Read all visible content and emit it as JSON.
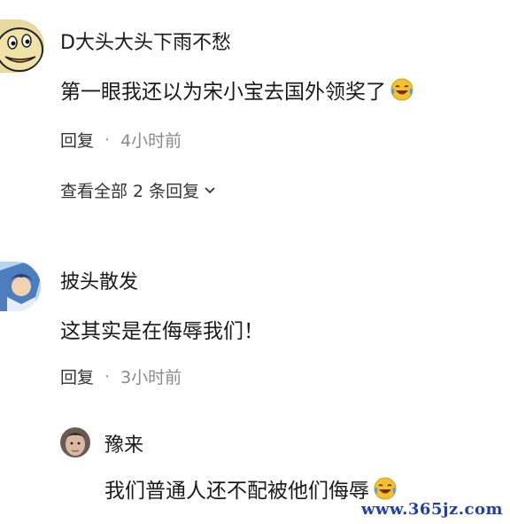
{
  "comments": [
    {
      "username": "D大头大头下雨不愁",
      "text": "第一眼我还以为宋小宝去国外领奖了",
      "emoji": "laughing-crying-emoji",
      "reply_label": "回复",
      "separator": "·",
      "time": "4小时前",
      "view_replies": "查看全部 2 条回复"
    },
    {
      "username": "披头散发",
      "text": "这其实是在侮辱我们！",
      "reply_label": "回复",
      "separator": "·",
      "time": "3小时前"
    }
  ],
  "reply": {
    "username": "豫来",
    "text": "我们普通人还不配被他们侮辱",
    "emoji": "laughing-crying-emoji"
  },
  "watermark": "www.365jz.com",
  "colors": {
    "emoji_face": "#f5c030",
    "emoji_tears": "#4aa3e8",
    "watermark": "#1f3fa8"
  }
}
